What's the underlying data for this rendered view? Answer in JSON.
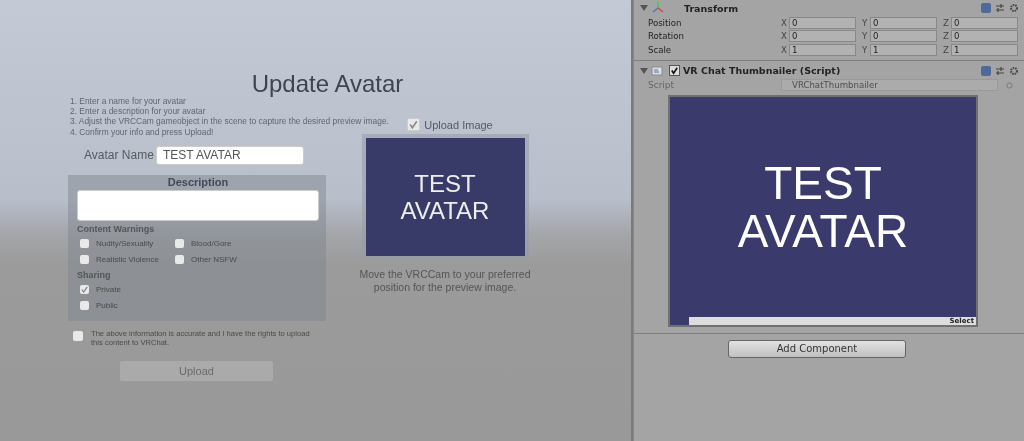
{
  "game_view": {
    "title": "Update Avatar",
    "instructions": [
      "1. Enter a name for your avatar",
      "2. Enter a description for your avatar",
      "3. Adjust the VRCCam gameobject in the scene to capture the desired preview image.",
      "4. Confirm your info and press Upload!"
    ],
    "avatar_name": {
      "label": "Avatar Name",
      "value": "TEST AVATAR"
    },
    "description": {
      "heading": "Description"
    },
    "content_warnings": {
      "heading": "Content Warnings",
      "options": [
        {
          "label": "Nudity/Sexuality",
          "checked": false
        },
        {
          "label": "Blood/Gore",
          "checked": false
        },
        {
          "label": "Realistic Violence",
          "checked": false
        },
        {
          "label": "Other NSFW",
          "checked": false
        }
      ]
    },
    "sharing": {
      "heading": "Sharing",
      "options": [
        {
          "label": "Private",
          "selected": true
        },
        {
          "label": "Public",
          "selected": false
        }
      ]
    },
    "rights": {
      "text": "The above information is accurate and I have the rights to upload this content to VRChat.",
      "checked": false
    },
    "upload_button": {
      "label": "Upload",
      "disabled": true
    },
    "upload_image": {
      "label": "Upload Image",
      "checked": true
    },
    "thumbnail_text": [
      "TEST",
      "AVATAR"
    ],
    "hint": "Move the VRCCam to your preferred position for the preview image."
  },
  "inspector": {
    "transform": {
      "title": "Transform",
      "expanded": true,
      "rows": [
        {
          "label": "Position",
          "fields": [
            {
              "axis": "X",
              "value": "0"
            },
            {
              "axis": "Y",
              "value": "0"
            },
            {
              "axis": "Z",
              "value": "0"
            }
          ]
        },
        {
          "label": "Rotation",
          "fields": [
            {
              "axis": "X",
              "value": "0"
            },
            {
              "axis": "Y",
              "value": "0"
            },
            {
              "axis": "Z",
              "value": "0"
            }
          ]
        },
        {
          "label": "Scale",
          "fields": [
            {
              "axis": "X",
              "value": "1"
            },
            {
              "axis": "Y",
              "value": "1"
            },
            {
              "axis": "Z",
              "value": "1"
            }
          ]
        }
      ]
    },
    "script_component": {
      "title": "VR Chat Thumbnailer (Script)",
      "enabled": true,
      "expanded": true,
      "script_label": "Script",
      "script_value": "VRChatThumbnailer",
      "preview_text": [
        "TEST",
        "AVATAR"
      ],
      "select_label": "Select"
    },
    "add_component": "Add Component"
  }
}
